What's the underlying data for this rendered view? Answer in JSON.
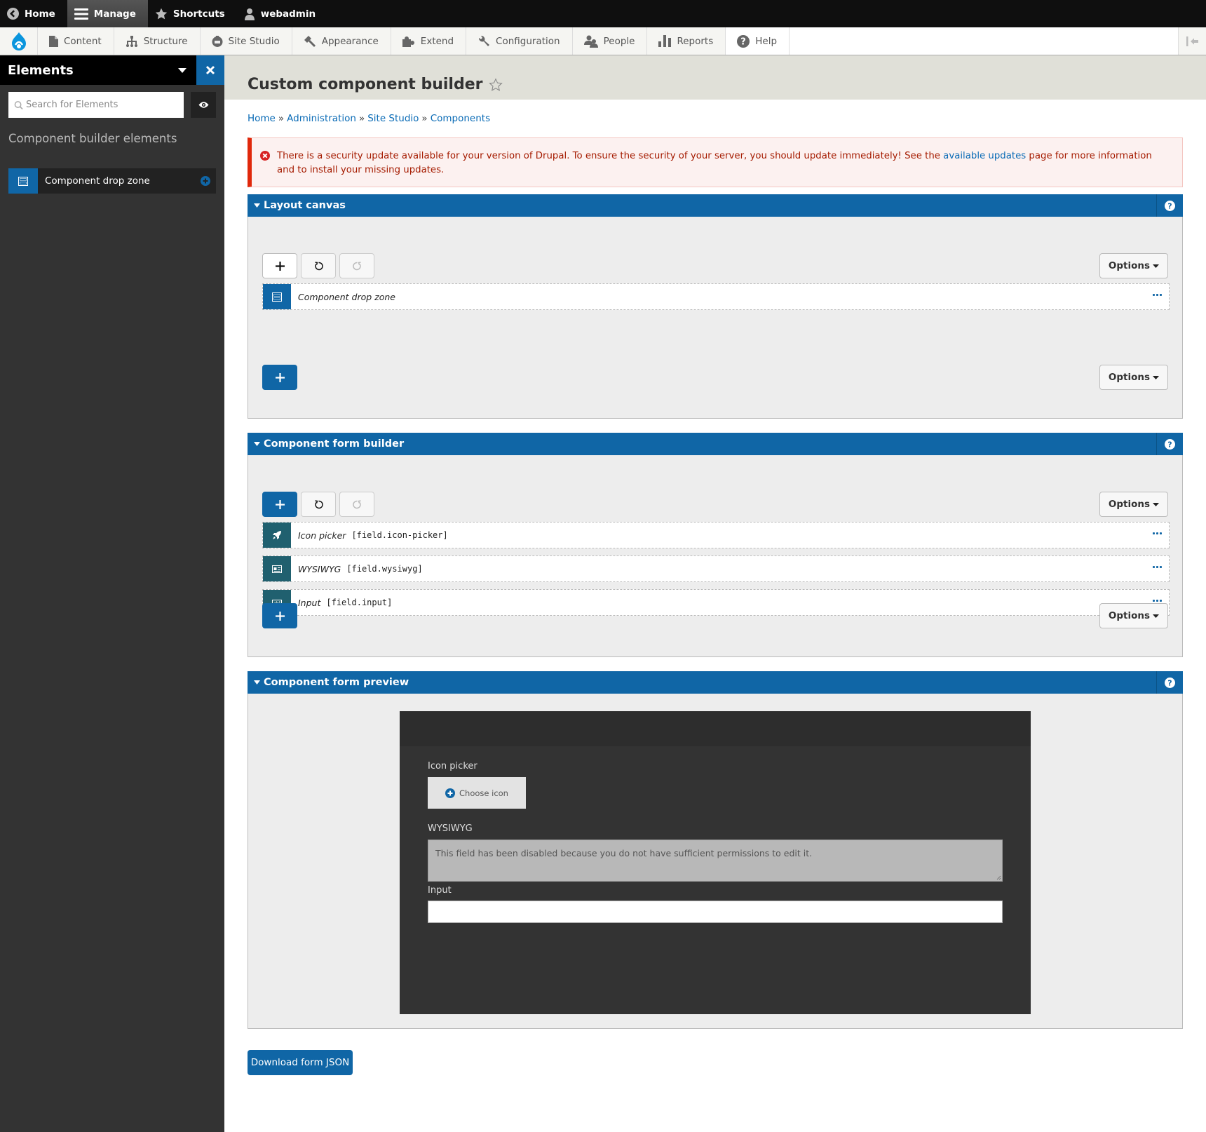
{
  "toolbar": {
    "items": [
      {
        "label": "Home",
        "icon": "back-chevron-icon"
      },
      {
        "label": "Manage",
        "icon": "hamburger-icon",
        "active": true
      },
      {
        "label": "Shortcuts",
        "icon": "star-icon"
      },
      {
        "label": "webadmin",
        "icon": "user-icon"
      }
    ]
  },
  "nav": {
    "items": [
      {
        "label": "Content",
        "icon": "document-icon"
      },
      {
        "label": "Structure",
        "icon": "sitemap-icon"
      },
      {
        "label": "Site Studio",
        "icon": "site-studio-icon"
      },
      {
        "label": "Appearance",
        "icon": "paintbrush-icon"
      },
      {
        "label": "Extend",
        "icon": "puzzle-icon"
      },
      {
        "label": "Configuration",
        "icon": "wrench-icon"
      },
      {
        "label": "People",
        "icon": "people-icon"
      },
      {
        "label": "Reports",
        "icon": "bar-chart-icon"
      },
      {
        "label": "Help",
        "icon": "help-icon"
      }
    ]
  },
  "sidebar": {
    "title": "Elements",
    "search_placeholder": "Search for Elements",
    "section_title": "Component builder elements",
    "items": [
      {
        "label": "Component drop zone",
        "icon": "drop-zone-icon"
      }
    ]
  },
  "page": {
    "title": "Custom component builder",
    "breadcrumb": [
      "Home",
      "Administration",
      "Site Studio",
      "Components"
    ],
    "breadcrumb_separator": "»"
  },
  "alert": {
    "text_before": "There is a security update available for your version of Drupal. To ensure the security of your server, you should update immediately! See the ",
    "link": "available updates",
    "text_after": " page for more information and to install your missing updates."
  },
  "layout_canvas": {
    "title": "Layout canvas",
    "options_label": "Options",
    "items": [
      {
        "name": "Component drop zone",
        "machine": ""
      }
    ]
  },
  "form_builder": {
    "title": "Component form builder",
    "options_label": "Options",
    "items": [
      {
        "name": "Icon picker",
        "machine": "[field.icon-picker]"
      },
      {
        "name": "WYSIWYG",
        "machine": "[field.wysiwyg]"
      },
      {
        "name": "Input",
        "machine": "[field.input]"
      }
    ]
  },
  "form_preview": {
    "title": "Component form preview",
    "icon_picker_label": "Icon picker",
    "choose_icon_label": "Choose icon",
    "wysiwyg_label": "WYSIWYG",
    "wysiwyg_disabled_text": "This field has been disabled because you do not have sufficient permissions to edit it.",
    "input_label": "Input",
    "input_value": ""
  },
  "download_label": "Download form JSON",
  "colors": {
    "primary": "#1066a6",
    "teal": "#20606f",
    "alert_text": "#a51b00",
    "alert_border": "#e0280b"
  }
}
